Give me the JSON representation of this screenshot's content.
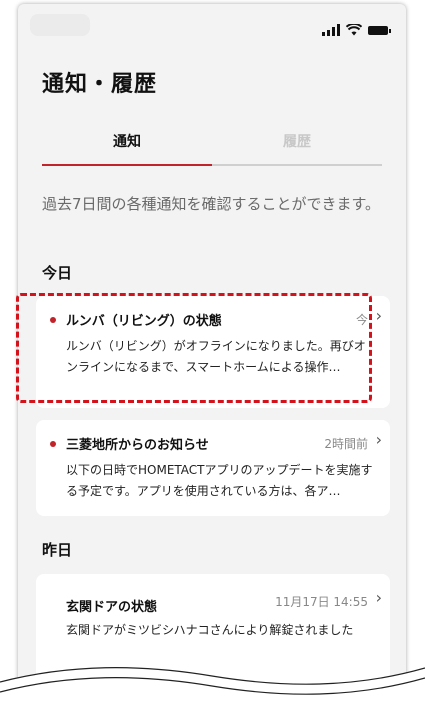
{
  "status_bar": {
    "icons": [
      "signal-icon",
      "wifi-icon",
      "battery-icon"
    ]
  },
  "header": {
    "title": "通知・履歴"
  },
  "tabs": [
    {
      "label": "通知",
      "active": true
    },
    {
      "label": "履歴",
      "active": false
    }
  ],
  "description": "過去7日間の各種通知を確認することができます。",
  "sections": {
    "today": {
      "label": "今日",
      "items": [
        {
          "title": "ルンバ（リビング）の状態",
          "time": "今",
          "body": "ルンバ（リビング）がオフラインになりました。再びオンラインになるまで、スマートホームによる操作…",
          "unread": true
        },
        {
          "title": "三菱地所からのお知らせ",
          "time": "2時間前",
          "body": "以下の日時でHOMETACTアプリのアップデートを実施する予定です。アプリを使用されている方は、各ア…",
          "unread": true
        }
      ]
    },
    "yesterday": {
      "label": "昨日",
      "items": [
        {
          "title": "玄関ドアの状態",
          "time": "11月17日 14:55",
          "body": "玄関ドアがミツビシハナコさんにより解錠されました",
          "unread": false
        }
      ]
    }
  },
  "colors": {
    "accent": "#c1232b",
    "highlight": "#d4121c",
    "background": "#f3f3f3"
  }
}
